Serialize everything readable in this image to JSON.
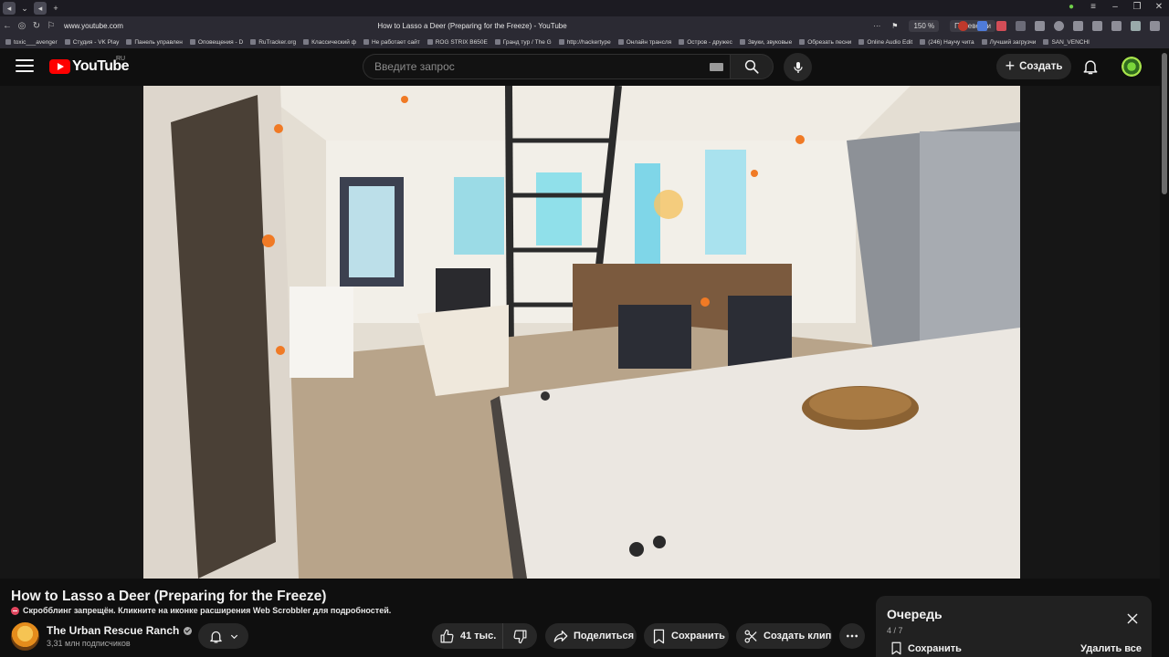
{
  "browser": {
    "url": "www.youtube.com",
    "tab_title": "How to Lasso a Deer (Preparing for the Freeze) - YouTube",
    "zoom": "150 %",
    "translate_label": "Перевести",
    "bookmarks": [
      "toxic___avenger",
      "Студия - VK Play",
      "Панель управлен",
      "Оповещения - D",
      "RuTracker.org",
      "Классический ф",
      "Не работает сайт",
      "ROG STRIX B650E",
      "Гранд тур / The G",
      "http://hackertype",
      "Онлайн трансля",
      "Остров - дружес",
      "Звуки, звуковые",
      "Обрезать песни",
      "Online Audio Edit",
      "(246) Научу чита",
      "Лучший загрузчи",
      "SAN_VENCHI"
    ]
  },
  "header": {
    "logo_text": "YouTube",
    "region": "RU",
    "search_placeholder": "Введите запрос",
    "create_label": "Создать"
  },
  "video": {
    "title": "How to Lasso a Deer (Preparing for the Freeze)",
    "scrobble_notice": "Скробблинг запрещён. Кликните на иконке расширения Web Scrobbler для подробностей.",
    "channel_name": "The Urban Rescue Ranch",
    "subscribers": "3,31 млн подписчиков",
    "likes": "41 тыс.",
    "share_label": "Поделиться",
    "save_label": "Сохранить",
    "clip_label": "Создать клип"
  },
  "queue": {
    "title": "Очередь",
    "count": "4 / 7",
    "save_label": "Сохранить",
    "clear_label": "Удалить все"
  },
  "colors": {
    "background": "#0f0f0f",
    "brand_red": "#ff0000",
    "button_bg": "#272727",
    "chrome_bg": "#2b2a33"
  }
}
